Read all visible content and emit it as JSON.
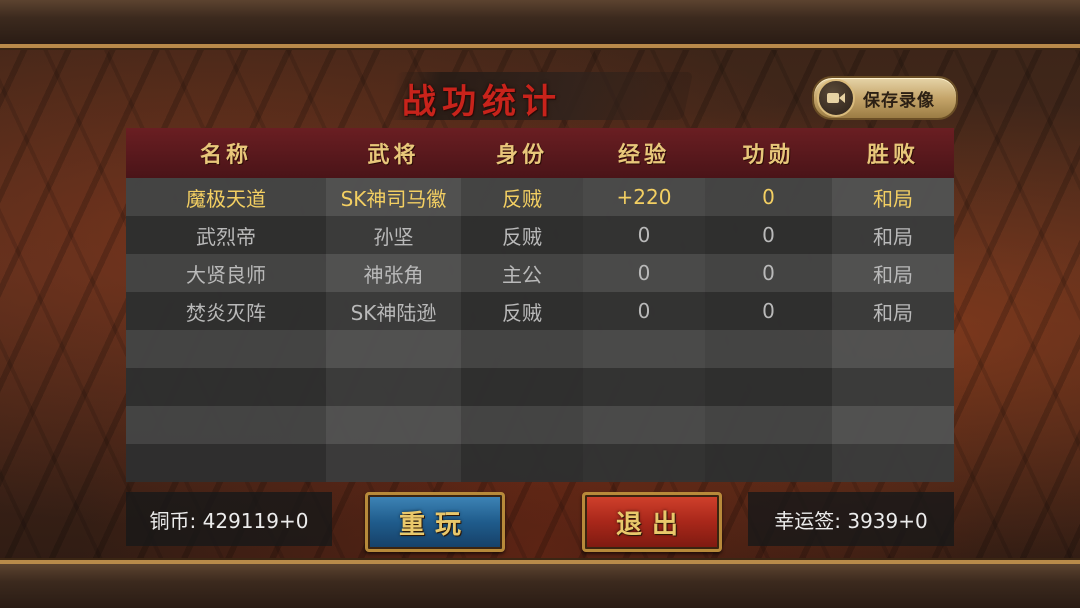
{
  "title": "战功统计",
  "save_button": {
    "label": "保存录像",
    "icon": "video-camera-icon"
  },
  "table": {
    "headers": [
      "名称",
      "武将",
      "身份",
      "经验",
      "功勋",
      "胜败"
    ],
    "rows": [
      {
        "name": "魔极天道",
        "general": "SK神司马徽",
        "role": "反贼",
        "exp": "+220",
        "merit": "0",
        "result": "和局",
        "highlight": true
      },
      {
        "name": "武烈帝",
        "general": "孙坚",
        "role": "反贼",
        "exp": "0",
        "merit": "0",
        "result": "和局",
        "highlight": false
      },
      {
        "name": "大贤良师",
        "general": "神张角",
        "role": "主公",
        "exp": "0",
        "merit": "0",
        "result": "和局",
        "highlight": false
      },
      {
        "name": "焚炎灭阵",
        "general": "SK神陆逊",
        "role": "反贼",
        "exp": "0",
        "merit": "0",
        "result": "和局",
        "highlight": false
      },
      {
        "name": "",
        "general": "",
        "role": "",
        "exp": "",
        "merit": "",
        "result": "",
        "highlight": false
      },
      {
        "name": "",
        "general": "",
        "role": "",
        "exp": "",
        "merit": "",
        "result": "",
        "highlight": false
      },
      {
        "name": "",
        "general": "",
        "role": "",
        "exp": "",
        "merit": "",
        "result": "",
        "highlight": false
      },
      {
        "name": "",
        "general": "",
        "role": "",
        "exp": "",
        "merit": "",
        "result": "",
        "highlight": false
      }
    ]
  },
  "coins": {
    "text": "铜币: 429119+0"
  },
  "lucky": {
    "text": "幸运签: 3939+0"
  },
  "buttons": {
    "replay": "重玩",
    "exit": "退出"
  },
  "colors": {
    "highlight_text": "#f3cf62",
    "header_bg": "#5a1a1e",
    "header_text": "#e8c77a",
    "title_text": "#c8231b"
  }
}
